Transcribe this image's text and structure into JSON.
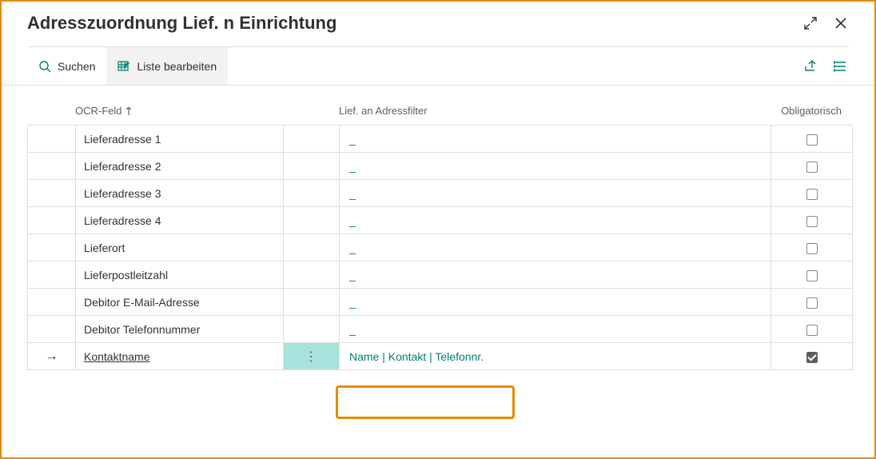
{
  "header": {
    "title": "Adresszuordnung  Lief. n Einrichtung"
  },
  "toolbar": {
    "search_label": "Suchen",
    "edit_list_label": "Liste bearbeiten"
  },
  "columns": {
    "ocr_feld": "OCR-Feld",
    "addressfilter": "Lief. an Adressfilter",
    "obligatorisch": "Obligatorisch"
  },
  "rows": [
    {
      "ocr": "Lieferadresse 1",
      "filter": "_",
      "oblig": false,
      "selected": false
    },
    {
      "ocr": "Lieferadresse 2",
      "filter": "_",
      "oblig": false,
      "selected": false
    },
    {
      "ocr": "Lieferadresse 3",
      "filter": "_",
      "oblig": false,
      "selected": false
    },
    {
      "ocr": "Lieferadresse 4",
      "filter": "_",
      "oblig": false,
      "selected": false
    },
    {
      "ocr": "Lieferort",
      "filter": "_",
      "oblig": false,
      "selected": false
    },
    {
      "ocr": "Lieferpostleitzahl",
      "filter": "_",
      "oblig": false,
      "selected": false
    },
    {
      "ocr": "Debitor E-Mail-Adresse",
      "filter": "_",
      "oblig": false,
      "selected": false
    },
    {
      "ocr": "Debitor Telefonnummer",
      "filter": "_",
      "oblig": false,
      "selected": false
    },
    {
      "ocr": "Kontaktname",
      "filter": "Name | Kontakt | Telefonnr.",
      "oblig": true,
      "selected": true
    }
  ]
}
